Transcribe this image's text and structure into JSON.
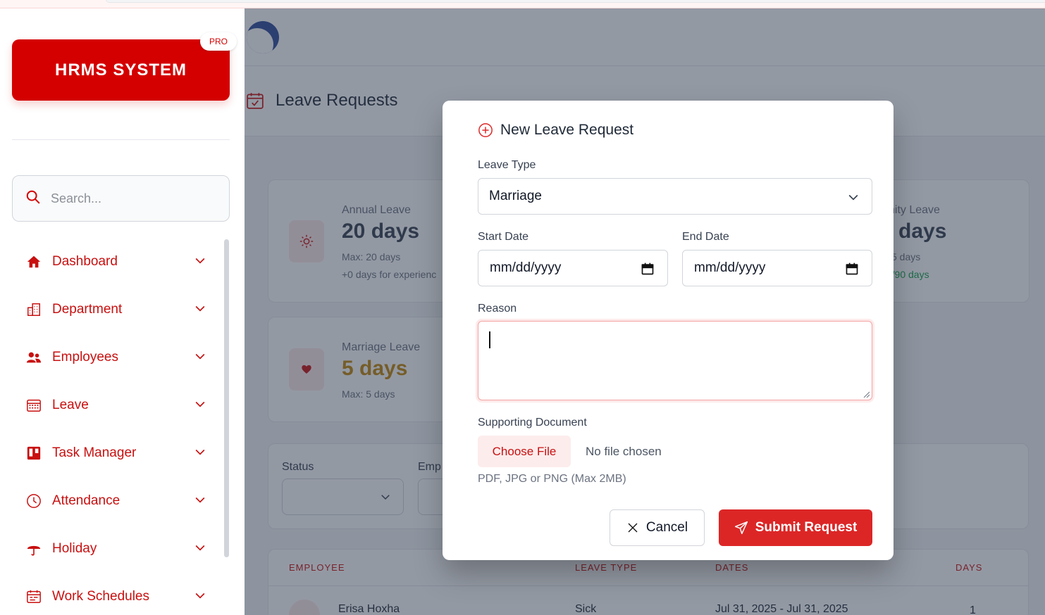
{
  "brand": {
    "name": "HRMS SYSTEM",
    "badge": "PRO"
  },
  "search": {
    "placeholder": "Search..."
  },
  "sidebar": {
    "items": [
      {
        "label": "Dashboard",
        "icon": "home-icon"
      },
      {
        "label": "Department",
        "icon": "building-icon"
      },
      {
        "label": "Employees",
        "icon": "users-icon"
      },
      {
        "label": "Leave",
        "icon": "calendar-grid-icon"
      },
      {
        "label": "Task Manager",
        "icon": "kanban-icon"
      },
      {
        "label": "Attendance",
        "icon": "clock-icon"
      },
      {
        "label": "Holiday",
        "icon": "umbrella-icon"
      },
      {
        "label": "Work Schedules",
        "icon": "schedule-icon"
      }
    ]
  },
  "page": {
    "title": "Leave Requests"
  },
  "stats": {
    "annual": {
      "label": "Annual Leave",
      "value": "20 days",
      "max": "Max: 20 days",
      "extra": "+0 days for experienc"
    },
    "maternity": {
      "label": "nity Leave",
      "value": "days",
      "max": "5 days",
      "extra": ")/90 days"
    },
    "marriage": {
      "label": "Marriage Leave",
      "value": "5 days",
      "max": "Max: 5 days"
    }
  },
  "filters": {
    "status_label": "Status",
    "employee_label": "Emp"
  },
  "table": {
    "headers": [
      "EMPLOYEE",
      "LEAVE TYPE",
      "DATES",
      "DAYS"
    ],
    "rows": [
      {
        "employee": "Erisa Hoxha",
        "type": "Sick",
        "dates": "Jul 31, 2025 - Jul 31, 2025",
        "days": "1"
      }
    ]
  },
  "modal": {
    "title": "New Leave Request",
    "leave_type_label": "Leave Type",
    "leave_type_value": "Marriage",
    "start_label": "Start Date",
    "start_value": "mm/dd/yyyy",
    "end_label": "End Date",
    "end_value": "mm/dd/yyyy",
    "reason_label": "Reason",
    "doc_label": "Supporting Document",
    "choose_file": "Choose File",
    "no_file": "No file chosen",
    "hint": "PDF, JPG or PNG (Max 2MB)",
    "cancel": "Cancel",
    "submit": "Submit Request"
  },
  "colors": {
    "brand": "#d40000",
    "accent": "#dc2626",
    "nav_text": "#c81010"
  }
}
